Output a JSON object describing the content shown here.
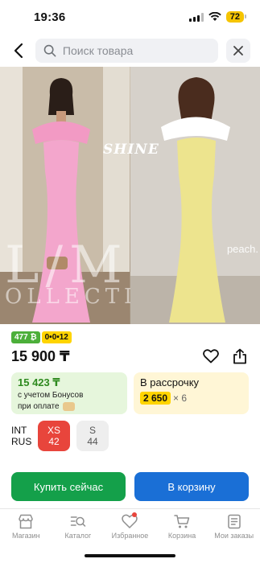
{
  "status_bar": {
    "time": "19:36",
    "battery": "72"
  },
  "search": {
    "placeholder": "Поиск товара"
  },
  "gallery": {
    "left_brand_big": "L/M",
    "left_brand_small": "OLLECTIO",
    "right_tag_top": "SHINE",
    "right_tag_side": "peach."
  },
  "badges": {
    "rating_count": "477 ₿",
    "installment_plan": "0•0•12"
  },
  "price": "15 900 ₸",
  "bonus": {
    "amount": "15 423 ₸",
    "line1": "с учетом Бонусов",
    "line2": "при оплате"
  },
  "installment": {
    "label": "В рассрочку",
    "amount": "2 650",
    "term": "× 6"
  },
  "sizes": {
    "labels": [
      "INT",
      "RUS"
    ],
    "options": [
      {
        "int": "XS",
        "rus": "42",
        "selected": true
      },
      {
        "int": "S",
        "rus": "44",
        "selected": false
      }
    ]
  },
  "actions": {
    "buy_now": "Купить сейчас",
    "add_to_cart": "В корзину"
  },
  "bottom_nav": [
    {
      "label": "Магазин",
      "icon": "store-icon"
    },
    {
      "label": "Каталог",
      "icon": "catalog-icon"
    },
    {
      "label": "Избранное",
      "icon": "heart-icon",
      "has_dot": true
    },
    {
      "label": "Корзина",
      "icon": "cart-icon"
    },
    {
      "label": "Мои заказы",
      "icon": "orders-icon"
    }
  ],
  "colors": {
    "accent_green": "#14a04a",
    "accent_blue": "#1a6fd6",
    "selected_size": "#e8453c",
    "badge_yellow": "#ffd400"
  }
}
